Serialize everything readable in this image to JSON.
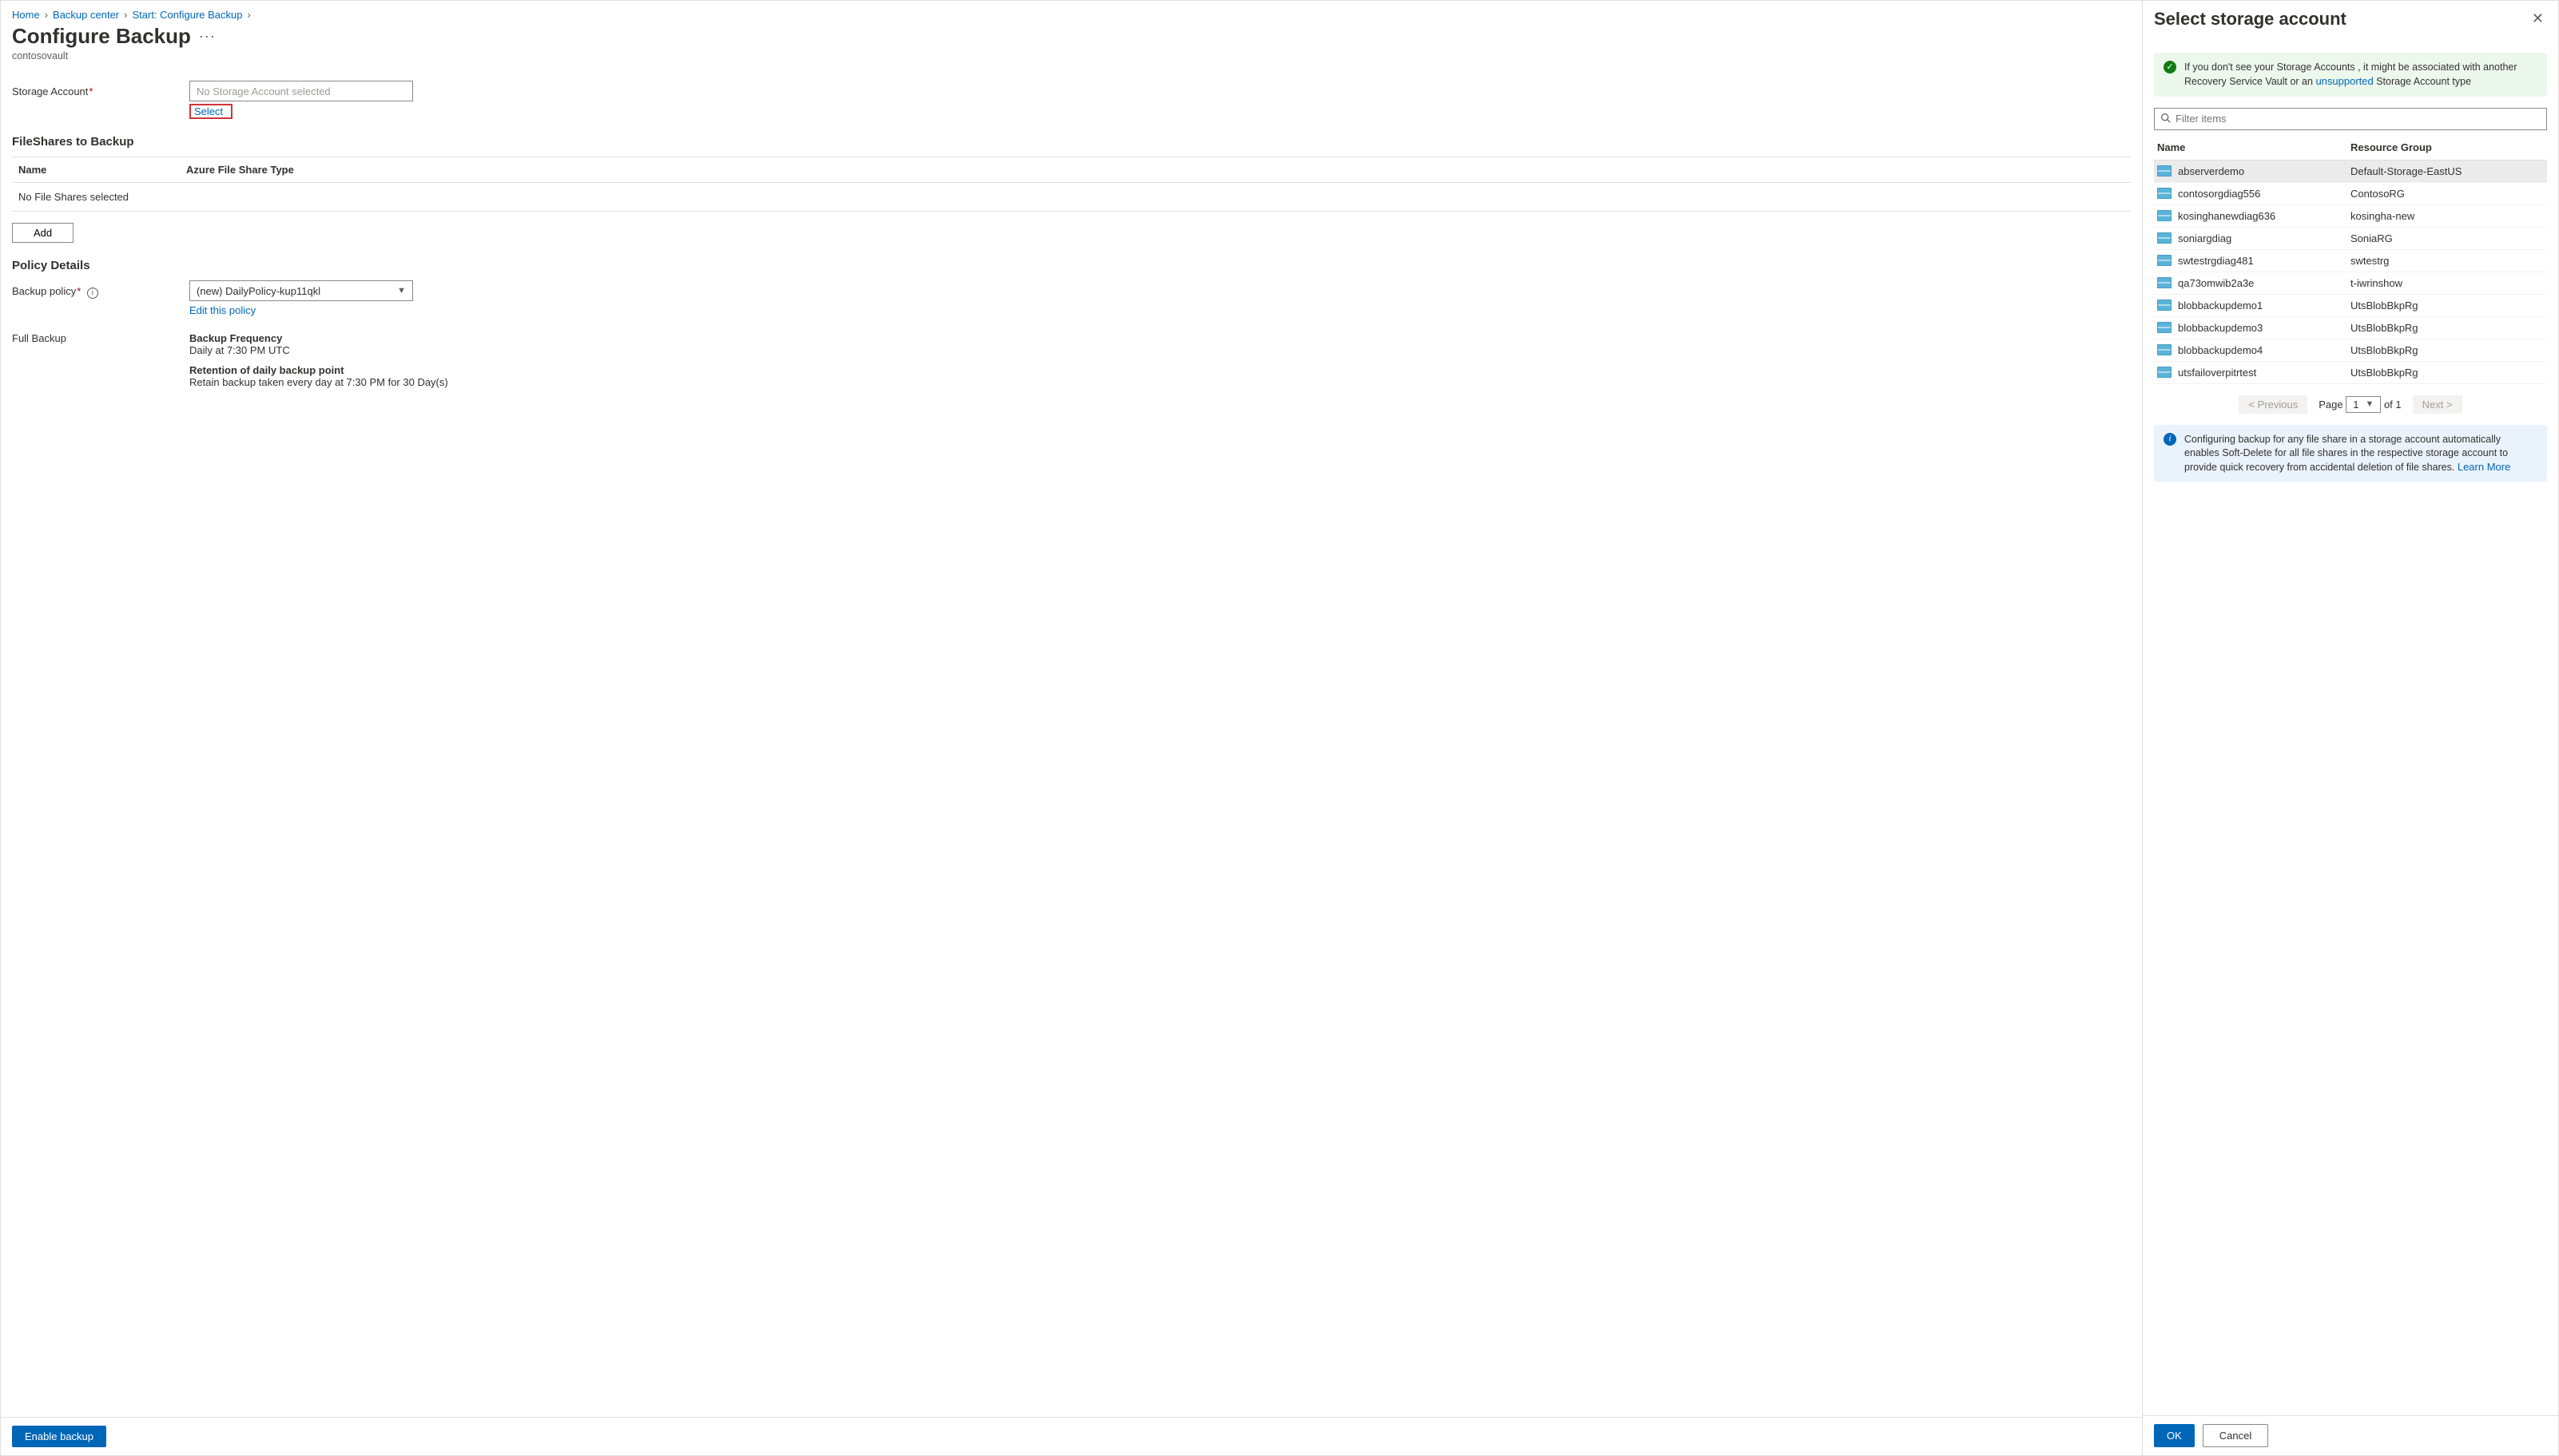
{
  "breadcrumbs": [
    "Home",
    "Backup center",
    "Start: Configure Backup"
  ],
  "title": "Configure Backup",
  "vault_name": "contosovault",
  "storage_account": {
    "label": "Storage Account",
    "placeholder": "No Storage Account selected",
    "select_link": "Select"
  },
  "fileshares": {
    "heading": "FileShares to Backup",
    "columns": {
      "name": "Name",
      "type": "Azure File Share Type"
    },
    "empty_text": "No File Shares selected",
    "add_button": "Add"
  },
  "policy": {
    "heading": "Policy Details",
    "label": "Backup policy",
    "value": "(new) DailyPolicy-kup11qkl",
    "edit_link": "Edit this policy",
    "full_backup_label": "Full Backup",
    "frequency_label": "Backup Frequency",
    "frequency_value": "Daily at 7:30 PM UTC",
    "retention_label": "Retention of daily backup point",
    "retention_value": "Retain backup taken every day at 7:30 PM for 30 Day(s)"
  },
  "enable_button": "Enable backup",
  "right": {
    "title": "Select storage account",
    "notice_pre": "If you don't see your Storage Accounts , it might be associated with another Recovery Service Vault or an ",
    "notice_link": "unsupported",
    "notice_post": " Storage Account type",
    "search_placeholder": "Filter items",
    "columns": {
      "name": "Name",
      "rg": "Resource Group"
    },
    "rows": [
      {
        "name": "abserverdemo",
        "rg": "Default-Storage-EastUS",
        "selected": true
      },
      {
        "name": "contosorgdiag556",
        "rg": "ContosoRG"
      },
      {
        "name": "kosinghanewdiag636",
        "rg": "kosingha-new"
      },
      {
        "name": "soniargdiag",
        "rg": "SoniaRG"
      },
      {
        "name": "swtestrgdiag481",
        "rg": "swtestrg"
      },
      {
        "name": "qa73omwib2a3e",
        "rg": "t-iwrinshow"
      },
      {
        "name": "blobbackupdemo1",
        "rg": "UtsBlobBkpRg"
      },
      {
        "name": "blobbackupdemo3",
        "rg": "UtsBlobBkpRg"
      },
      {
        "name": "blobbackupdemo4",
        "rg": "UtsBlobBkpRg"
      },
      {
        "name": "utsfailoverpitrtest",
        "rg": "UtsBlobBkpRg"
      }
    ],
    "pager": {
      "prev": "< Previous",
      "page_label": "Page",
      "page_value": "1",
      "of_label": "of",
      "total_pages": "1",
      "next": "Next >"
    },
    "info_pre": "Configuring backup for any file share in a storage account automatically enables Soft-Delete for all file shares in the respective storage account to provide quick recovery from accidental deletion of file shares. ",
    "info_link": "Learn More",
    "ok": "OK",
    "cancel": "Cancel"
  }
}
